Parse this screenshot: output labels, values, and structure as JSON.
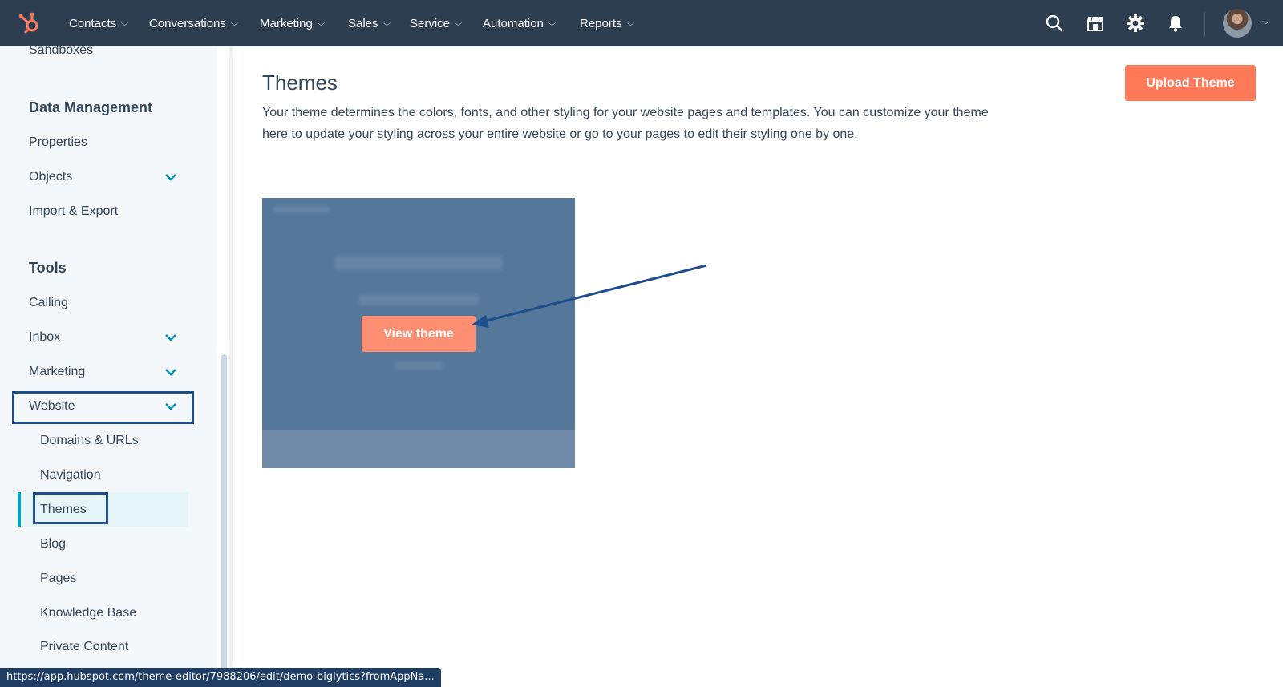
{
  "topnav": {
    "items": [
      "Contacts",
      "Conversations",
      "Marketing",
      "Sales",
      "Service",
      "Automation",
      "Reports"
    ],
    "icons": [
      "hubspot-logo",
      "search-icon",
      "marketplace-icon",
      "settings-icon",
      "notifications-icon",
      "user-avatar"
    ]
  },
  "sidebar": {
    "partial_item": "Sandboxes",
    "data_management": {
      "heading": "Data Management",
      "items": [
        "Properties",
        "Objects",
        "Import & Export"
      ]
    },
    "tools": {
      "heading": "Tools",
      "items": [
        "Calling",
        "Inbox",
        "Marketing",
        "Website"
      ]
    },
    "website_sub": [
      "Domains & URLs",
      "Navigation",
      "Themes",
      "Blog",
      "Pages",
      "Knowledge Base",
      "Private Content"
    ],
    "active_item": "Themes"
  },
  "main": {
    "title": "Themes",
    "description": "Your theme determines the colors, fonts, and other styling for your website pages and templates. You can customize your theme here to update your styling across your entire website or go to your pages to edit their styling one by one.",
    "upload_label": "Upload Theme",
    "view_theme_label": "View theme"
  },
  "status_url": "https://app.hubspot.com/theme-editor/7988206/edit/demo-biglytics?fromAppNa...",
  "colors": {
    "nav_bg": "#2d3e50",
    "accent": "#ff7a59",
    "active_bar": "#00a4bd",
    "highlight": "#1f4e8c"
  }
}
